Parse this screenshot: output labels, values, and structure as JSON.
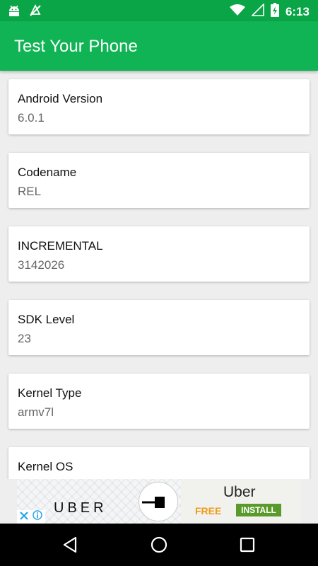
{
  "status_bar": {
    "time": "6:13",
    "icons": [
      "android-icon",
      "mute-icon",
      "wifi-icon",
      "signal-icon",
      "battery-charging-icon"
    ]
  },
  "app_bar": {
    "title": "Test Your Phone"
  },
  "cards": [
    {
      "title": "Android Version",
      "value": "6.0.1"
    },
    {
      "title": "Codename",
      "value": "REL"
    },
    {
      "title": "INCREMENTAL",
      "value": "3142026"
    },
    {
      "title": "SDK Level",
      "value": "23"
    },
    {
      "title": "Kernel Type",
      "value": "armv7l"
    },
    {
      "title": "Kernel OS",
      "value": ""
    }
  ],
  "ad": {
    "brand_word": "UBER",
    "app_name": "Uber",
    "price": "FREE",
    "install_label": "INSTALL"
  },
  "colors": {
    "status_bar": "#0aa546",
    "app_bar": "#10b454",
    "install_button": "#5a9a2c",
    "free_text": "#f09a19"
  },
  "nav_bar": {
    "buttons": [
      "back-icon",
      "home-icon",
      "recents-icon"
    ]
  }
}
